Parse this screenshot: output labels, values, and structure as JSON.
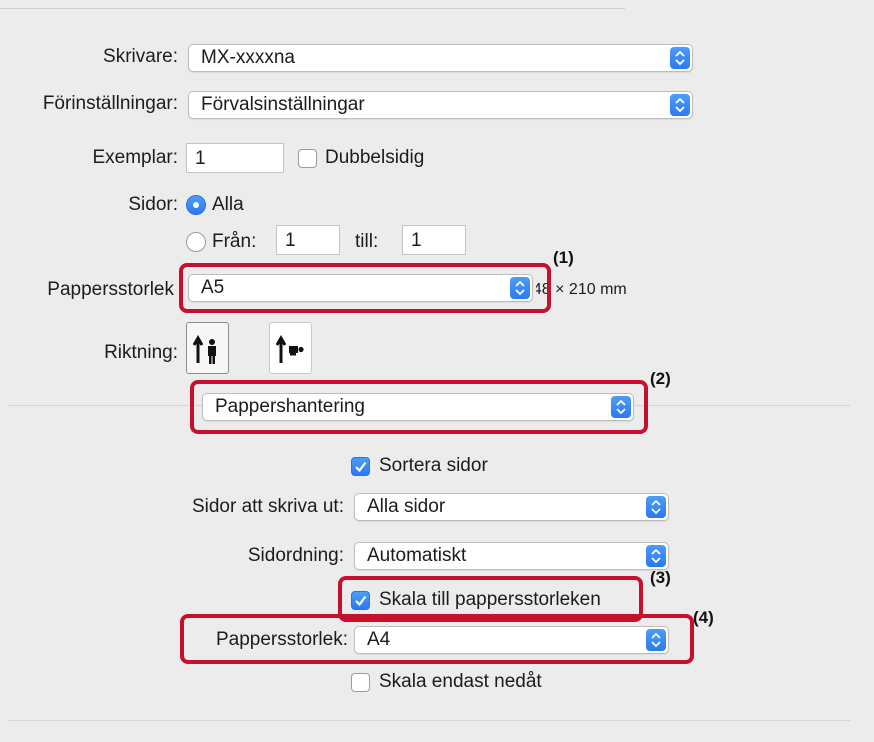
{
  "printer": {
    "label": "Skrivare:",
    "value": "MX-xxxxna"
  },
  "presets": {
    "label": "Förinställningar:",
    "value": "Förvalsinställningar"
  },
  "copies": {
    "label": "Exemplar:",
    "value": "1",
    "duplex_label": "Dubbelsidig",
    "duplex_checked": false
  },
  "pages": {
    "label": "Sidor:",
    "all_label": "Alla",
    "all_selected": true,
    "from_label": "Från:",
    "from_value": "1",
    "to_label": "till:",
    "to_value": "1"
  },
  "paper_size": {
    "label": "Pappersstorlek",
    "value": "A5",
    "dimensions": "148 × 210 mm"
  },
  "orientation": {
    "label": "Riktning:",
    "options": [
      "portrait-icon",
      "landscape-icon"
    ],
    "selected": "portrait-icon"
  },
  "panel_menu": {
    "value": "Pappershantering"
  },
  "paper_handling": {
    "collate_label": "Sortera sidor",
    "collate_checked": true,
    "pages_to_print_label": "Sidor att skriva ut:",
    "pages_to_print_value": "Alla sidor",
    "page_order_label": "Sidordning:",
    "page_order_value": "Automatiskt",
    "scale_to_fit_label": "Skala till pappersstorleken",
    "scale_to_fit_checked": true,
    "dest_paper_size_label": "Pappersstorlek:",
    "dest_paper_size_value": "A4",
    "scale_down_only_label": "Skala endast nedåt",
    "scale_down_only_checked": false
  },
  "callouts": {
    "c1": "(1)",
    "c2": "(2)",
    "c3": "(3)",
    "c4": "(4)"
  },
  "colors": {
    "accent": "#2a7af2",
    "highlight": "#c8102e",
    "background": "#ececec"
  }
}
